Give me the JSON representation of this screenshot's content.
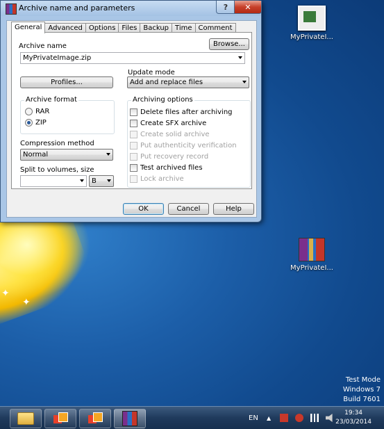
{
  "dialog": {
    "title": "Archive name and parameters",
    "tabs": [
      "General",
      "Advanced",
      "Options",
      "Files",
      "Backup",
      "Time",
      "Comment"
    ],
    "selected_tab": "General",
    "archive_name_label": "Archive name",
    "browse_label": "Browse...",
    "archive_name_value": "MyPrivateImage.zip",
    "profiles_label": "Profiles...",
    "update_mode_label": "Update mode",
    "update_mode_value": "Add and replace files",
    "archive_format": {
      "title": "Archive format",
      "options": [
        "RAR",
        "ZIP"
      ],
      "selected": "ZIP"
    },
    "compression_method_label": "Compression method",
    "compression_method_value": "Normal",
    "split_label": "Split to volumes, size",
    "split_value": "",
    "split_unit": "B",
    "archiving_options": {
      "title": "Archiving options",
      "items": [
        {
          "label": "Delete files after archiving",
          "checked": false,
          "enabled": true
        },
        {
          "label": "Create SFX archive",
          "checked": false,
          "enabled": true
        },
        {
          "label": "Create solid archive",
          "checked": false,
          "enabled": false
        },
        {
          "label": "Put authenticity verification",
          "checked": false,
          "enabled": false
        },
        {
          "label": "Put recovery record",
          "checked": false,
          "enabled": false
        },
        {
          "label": "Test archived files",
          "checked": false,
          "enabled": true
        },
        {
          "label": "Lock archive",
          "checked": false,
          "enabled": false
        }
      ]
    },
    "ok_label": "OK",
    "cancel_label": "Cancel",
    "help_label": "Help",
    "help_glyph": "?",
    "close_glyph": "✕"
  },
  "desktop": {
    "icons": [
      {
        "label": "MyPrivateI...",
        "icon": "image-file-icon"
      },
      {
        "label": "MyPrivateI...",
        "icon": "rar-archive-icon"
      }
    ],
    "watermark": [
      "Test Mode",
      "Windows 7",
      "Build 7601"
    ]
  },
  "taskbar": {
    "language": "EN",
    "tray_arrow": "▲",
    "time": "19:34",
    "date": "23/03/2014"
  }
}
